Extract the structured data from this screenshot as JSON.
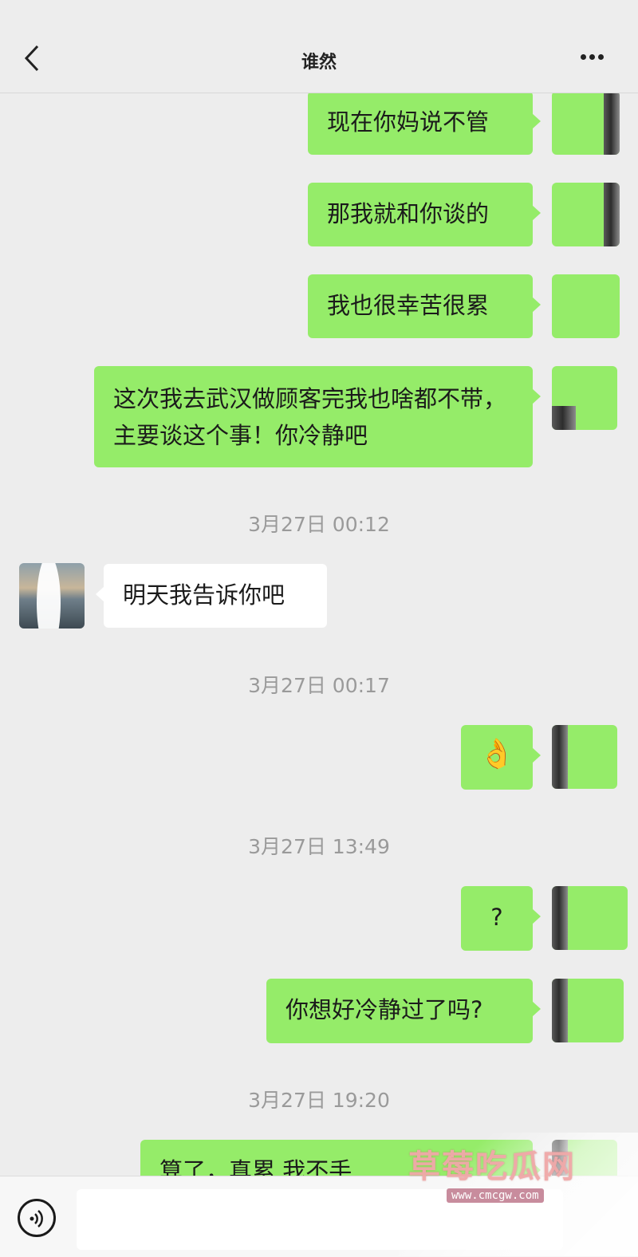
{
  "header": {
    "contact_name": "谁然"
  },
  "messages": [
    {
      "type": "out",
      "text": "现在你妈说不管"
    },
    {
      "type": "out",
      "text": "那我就和你谈的"
    },
    {
      "type": "out",
      "text": "我也很幸苦很累"
    },
    {
      "type": "out",
      "text": "这次我去武汉做顾客完我也啥都不带，主要谈这个事！你冷静吧"
    },
    {
      "type": "time",
      "text": "3月27日 00:12"
    },
    {
      "type": "in",
      "text": "明天我告诉你吧"
    },
    {
      "type": "time",
      "text": "3月27日 00:17"
    },
    {
      "type": "out",
      "text": "👌"
    },
    {
      "type": "time",
      "text": "3月27日 13:49"
    },
    {
      "type": "out",
      "text": "?"
    },
    {
      "type": "out",
      "text": "你想好冷静过了吗?"
    },
    {
      "type": "time",
      "text": "3月27日 19:20"
    },
    {
      "type": "out",
      "text": "算了，真累 我不手"
    }
  ],
  "watermark": {
    "text": "草莓吃瓜网",
    "url": "www.cmcgw.com"
  },
  "icons": {
    "back": "chevron-left",
    "more": "ellipsis",
    "voice": "voice-wave"
  }
}
